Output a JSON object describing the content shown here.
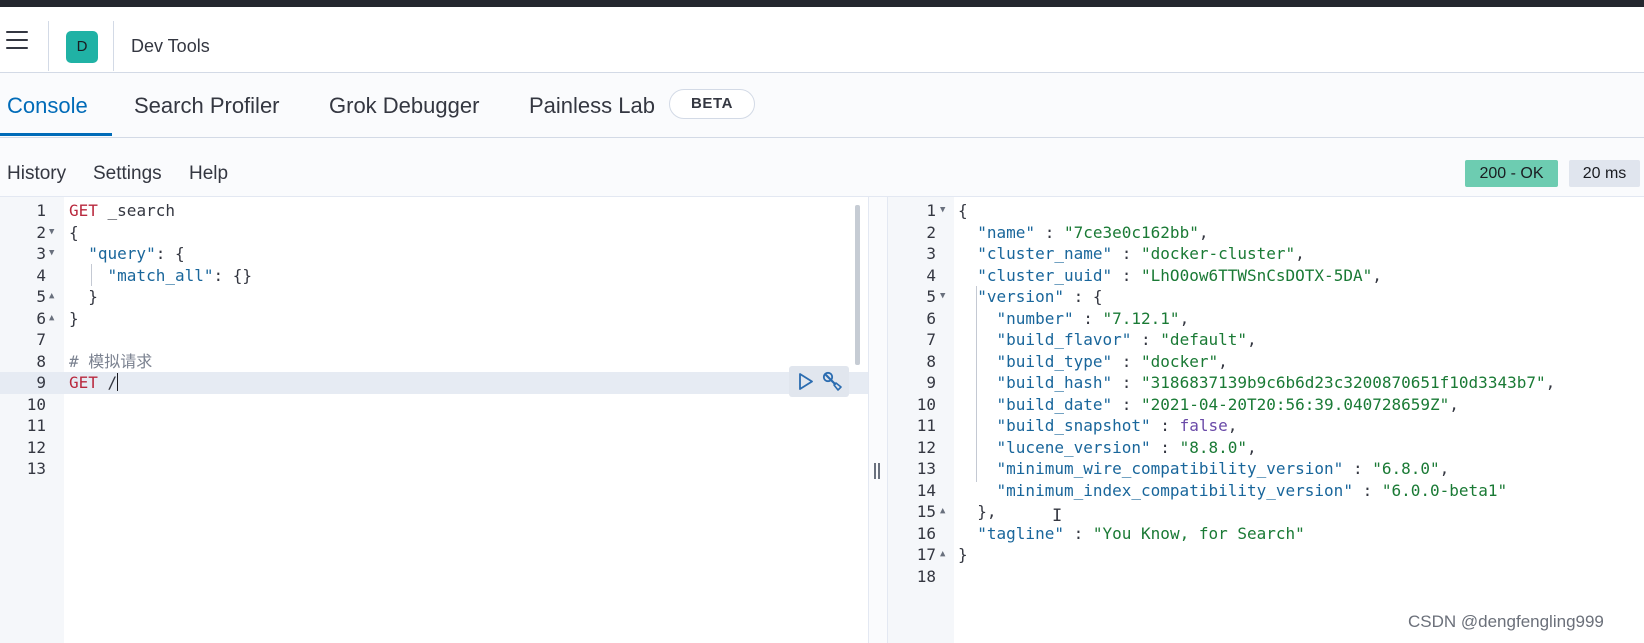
{
  "header": {
    "avatar_letter": "D",
    "app_title": "Dev Tools"
  },
  "tabs": [
    {
      "label": "Console",
      "active": true
    },
    {
      "label": "Search Profiler"
    },
    {
      "label": "Grok Debugger"
    },
    {
      "label": "Painless Lab"
    }
  ],
  "beta_badge": "BETA",
  "menu": {
    "history": "History",
    "settings": "Settings",
    "help": "Help"
  },
  "response": {
    "status": "200 - OK",
    "timing": "20 ms"
  },
  "editor": {
    "active_line": 9,
    "lines": [
      {
        "n": "1",
        "tokens": [
          [
            "GET",
            "method"
          ],
          [
            " _search",
            "punc"
          ]
        ]
      },
      {
        "n": "2",
        "fold": "down",
        "tokens": [
          [
            "{",
            "punc"
          ]
        ]
      },
      {
        "n": "3",
        "fold": "down",
        "tokens": [
          [
            "  ",
            "punc"
          ],
          [
            "\"query\"",
            "key"
          ],
          [
            ": {",
            "punc"
          ]
        ]
      },
      {
        "n": "4",
        "tokens": [
          [
            "    ",
            "punc"
          ],
          [
            "\"match_all\"",
            "key"
          ],
          [
            ": {}",
            "punc"
          ]
        ]
      },
      {
        "n": "5",
        "fold": "up",
        "tokens": [
          [
            "  }",
            "punc"
          ]
        ]
      },
      {
        "n": "6",
        "fold": "up",
        "tokens": [
          [
            "}",
            "punc"
          ]
        ]
      },
      {
        "n": "7",
        "tokens": []
      },
      {
        "n": "8",
        "tokens": [
          [
            "# 模拟请求",
            "comment"
          ]
        ]
      },
      {
        "n": "9",
        "tokens": [
          [
            "GET",
            "method"
          ],
          [
            " /",
            "punc"
          ]
        ]
      },
      {
        "n": "10",
        "tokens": []
      },
      {
        "n": "11",
        "tokens": []
      },
      {
        "n": "12",
        "tokens": []
      },
      {
        "n": "13",
        "tokens": []
      }
    ]
  },
  "output": {
    "lines": [
      {
        "n": "1",
        "fold": "down",
        "tokens": [
          [
            "{",
            "punc"
          ]
        ]
      },
      {
        "n": "2",
        "tokens": [
          [
            "  ",
            "punc"
          ],
          [
            "\"name\"",
            "key"
          ],
          [
            " : ",
            "punc"
          ],
          [
            "\"7ce3e0c162bb\"",
            "str"
          ],
          [
            ",",
            "punc"
          ]
        ]
      },
      {
        "n": "3",
        "tokens": [
          [
            "  ",
            "punc"
          ],
          [
            "\"cluster_name\"",
            "key"
          ],
          [
            " : ",
            "punc"
          ],
          [
            "\"docker-cluster\"",
            "str"
          ],
          [
            ",",
            "punc"
          ]
        ]
      },
      {
        "n": "4",
        "tokens": [
          [
            "  ",
            "punc"
          ],
          [
            "\"cluster_uuid\"",
            "key"
          ],
          [
            " : ",
            "punc"
          ],
          [
            "\"LhO0ow6TTWSnCsDOTX-5DA\"",
            "str"
          ],
          [
            ",",
            "punc"
          ]
        ]
      },
      {
        "n": "5",
        "fold": "down",
        "tokens": [
          [
            "  ",
            "punc"
          ],
          [
            "\"version\"",
            "key"
          ],
          [
            " : {",
            "punc"
          ]
        ]
      },
      {
        "n": "6",
        "tokens": [
          [
            "    ",
            "punc"
          ],
          [
            "\"number\"",
            "key"
          ],
          [
            " : ",
            "punc"
          ],
          [
            "\"7.12.1\"",
            "str"
          ],
          [
            ",",
            "punc"
          ]
        ]
      },
      {
        "n": "7",
        "tokens": [
          [
            "    ",
            "punc"
          ],
          [
            "\"build_flavor\"",
            "key"
          ],
          [
            " : ",
            "punc"
          ],
          [
            "\"default\"",
            "str"
          ],
          [
            ",",
            "punc"
          ]
        ]
      },
      {
        "n": "8",
        "tokens": [
          [
            "    ",
            "punc"
          ],
          [
            "\"build_type\"",
            "key"
          ],
          [
            " : ",
            "punc"
          ],
          [
            "\"docker\"",
            "str"
          ],
          [
            ",",
            "punc"
          ]
        ]
      },
      {
        "n": "9",
        "tokens": [
          [
            "    ",
            "punc"
          ],
          [
            "\"build_hash\"",
            "key"
          ],
          [
            " : ",
            "punc"
          ],
          [
            "\"3186837139b9c6b6d23c3200870651f10d3343b7\"",
            "str"
          ],
          [
            ",",
            "punc"
          ]
        ]
      },
      {
        "n": "10",
        "tokens": [
          [
            "    ",
            "punc"
          ],
          [
            "\"build_date\"",
            "key"
          ],
          [
            " : ",
            "punc"
          ],
          [
            "\"2021-04-20T20:56:39.040728659Z\"",
            "str"
          ],
          [
            ",",
            "punc"
          ]
        ]
      },
      {
        "n": "11",
        "tokens": [
          [
            "    ",
            "punc"
          ],
          [
            "\"build_snapshot\"",
            "key"
          ],
          [
            " : ",
            "punc"
          ],
          [
            "false",
            "bool"
          ],
          [
            ",",
            "punc"
          ]
        ]
      },
      {
        "n": "12",
        "tokens": [
          [
            "    ",
            "punc"
          ],
          [
            "\"lucene_version\"",
            "key"
          ],
          [
            " : ",
            "punc"
          ],
          [
            "\"8.8.0\"",
            "str"
          ],
          [
            ",",
            "punc"
          ]
        ]
      },
      {
        "n": "13",
        "tokens": [
          [
            "    ",
            "punc"
          ],
          [
            "\"minimum_wire_compatibility_version\"",
            "key"
          ],
          [
            " : ",
            "punc"
          ],
          [
            "\"6.8.0\"",
            "str"
          ],
          [
            ",",
            "punc"
          ]
        ]
      },
      {
        "n": "14",
        "tokens": [
          [
            "    ",
            "punc"
          ],
          [
            "\"minimum_index_compatibility_version\"",
            "key"
          ],
          [
            " : ",
            "punc"
          ],
          [
            "\"6.0.0-beta1\"",
            "str"
          ]
        ]
      },
      {
        "n": "15",
        "fold": "up",
        "tokens": [
          [
            "  },",
            "punc"
          ]
        ]
      },
      {
        "n": "16",
        "tokens": [
          [
            "  ",
            "punc"
          ],
          [
            "\"tagline\"",
            "key"
          ],
          [
            " : ",
            "punc"
          ],
          [
            "\"You Know, for Search\"",
            "str"
          ]
        ]
      },
      {
        "n": "17",
        "fold": "up",
        "tokens": [
          [
            "}",
            "punc"
          ]
        ]
      },
      {
        "n": "18",
        "tokens": []
      }
    ]
  },
  "watermark": "CSDN @dengfengling999",
  "icons": {
    "menu": "hamburger-menu-icon",
    "play": "play-icon",
    "wrench": "wrench-icon",
    "resize": "resize-handle-icon"
  },
  "colors": {
    "accent": "#006bb8",
    "status_ok": "#6dccb1",
    "method": "#b9293e",
    "key": "#19669b",
    "string": "#1a7a35",
    "avatar": "#20b2a5"
  }
}
